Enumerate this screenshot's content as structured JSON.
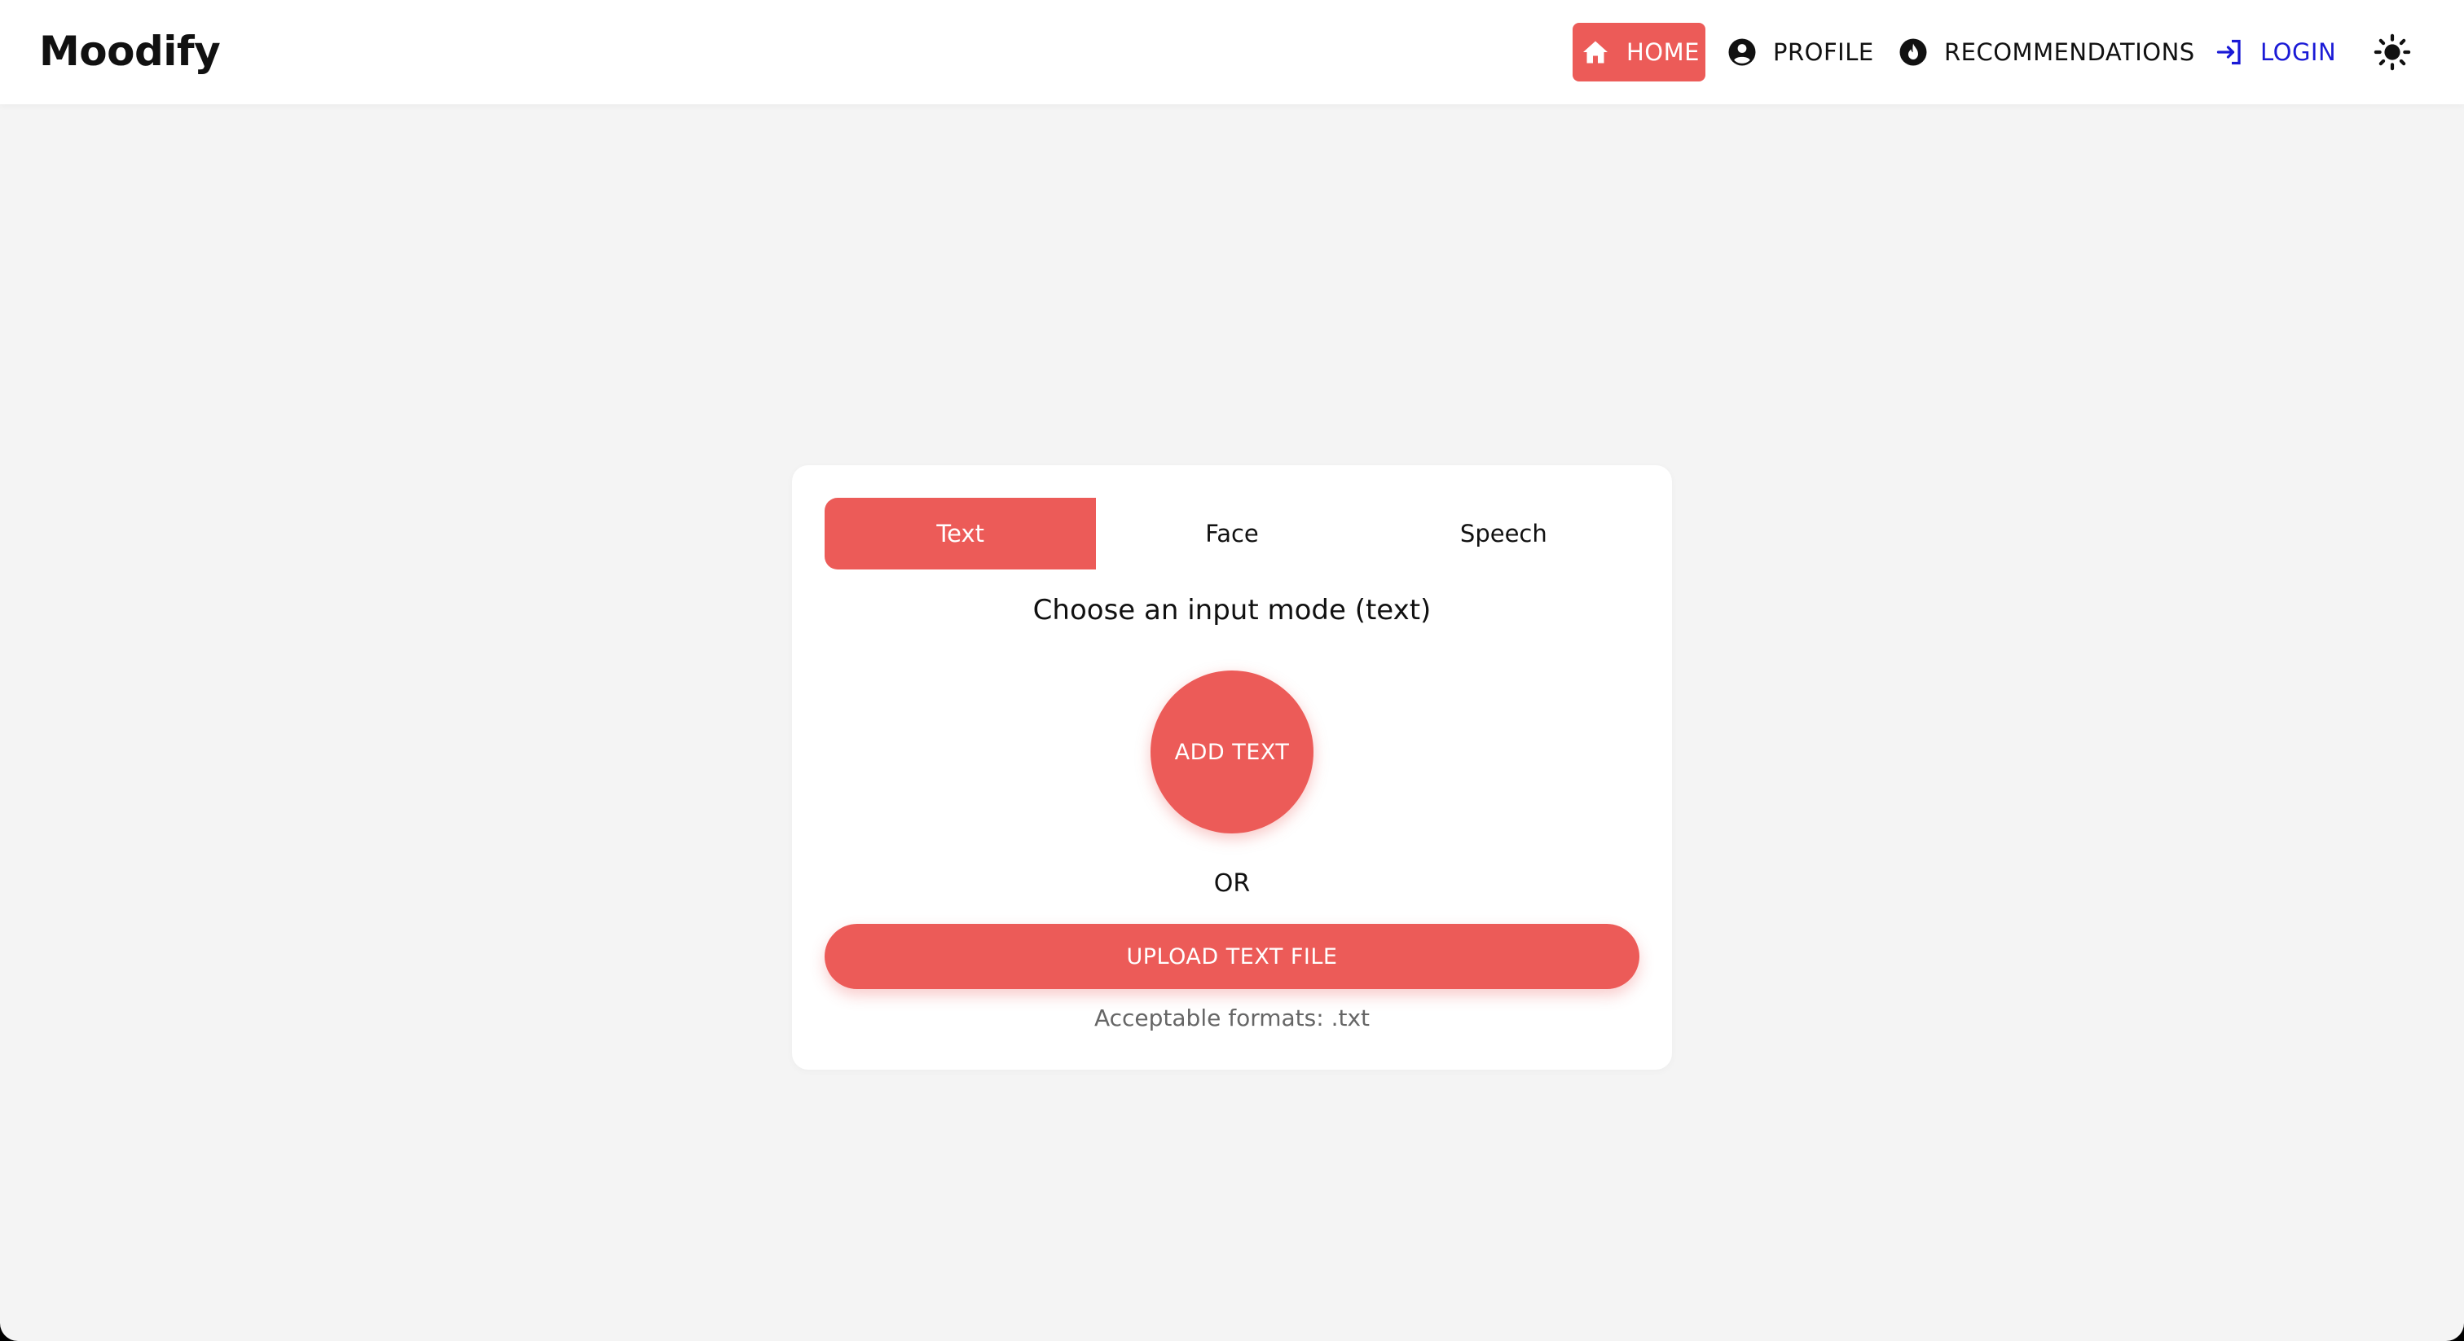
{
  "colors": {
    "accent": "#ec5b58",
    "login": "#1a1ad6",
    "background": "#f4f4f4"
  },
  "header": {
    "brand": "Moodify",
    "nav": {
      "home": {
        "label": "HOME",
        "icon": "home-icon"
      },
      "profile": {
        "label": "PROFILE",
        "icon": "user-circle-icon"
      },
      "recommendations": {
        "label": "RECOMMENDATIONS",
        "icon": "fire-icon"
      },
      "login": {
        "label": "LOGIN",
        "icon": "login-icon"
      },
      "theme": {
        "icon": "sun-icon"
      }
    }
  },
  "card": {
    "tabs": [
      "Text",
      "Face",
      "Speech"
    ],
    "active_tab": "Text",
    "mode_label": "Choose an input mode (text)",
    "add_text_label": "ADD TEXT",
    "or_label": "OR",
    "upload_label": "UPLOAD TEXT FILE",
    "formats_label": "Acceptable formats: .txt"
  }
}
